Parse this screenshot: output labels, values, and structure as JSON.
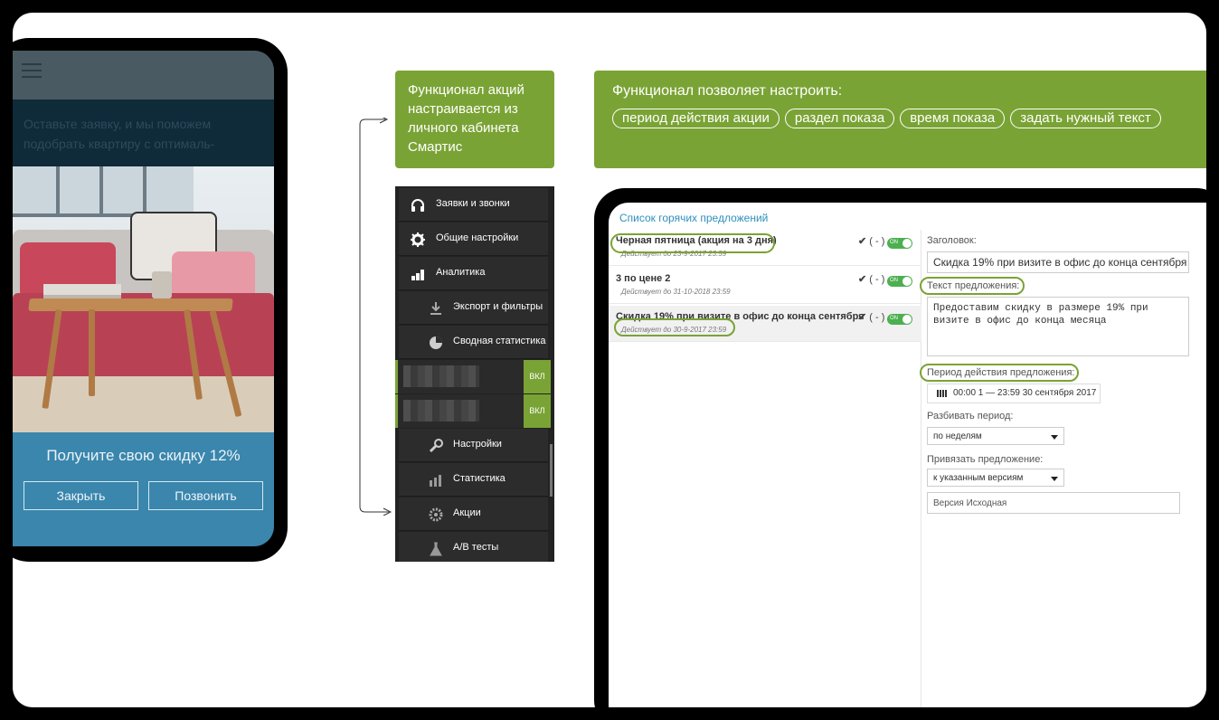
{
  "phone": {
    "description": "Оставьте заявку, и мы поможем подобрать квартиру с оптималь-",
    "promo_title": "Получите свою скидку 12%",
    "close_button": "Закрыть",
    "call_button": "Позвонить"
  },
  "intro_box": {
    "text": "Функционал акций настраивается из личного кабинета Смартис"
  },
  "features_box": {
    "title": "Функционал позволяет настроить:",
    "pills": [
      "период действия акции",
      "раздел показа",
      "время показа",
      "задать нужный текст"
    ]
  },
  "menu": {
    "items": [
      {
        "label": "Заявки и звонки",
        "icon": "headphones-icon"
      },
      {
        "label": "Общие настройки",
        "icon": "gear-icon"
      },
      {
        "label": "Аналитика",
        "icon": "bar-chart-icon"
      },
      {
        "label": "Экспорт и фильтры",
        "icon": "download-icon"
      },
      {
        "label": "Сводная статистика",
        "icon": "pie-chart-icon"
      },
      {
        "label": "Настройки",
        "icon": "wrench-icon"
      },
      {
        "label": "Статистика",
        "icon": "stats-icon"
      },
      {
        "label": "Акции",
        "icon": "badge-icon"
      },
      {
        "label": "A/B тесты",
        "icon": "flask-icon"
      }
    ],
    "blurred_badge": "ВКЛ"
  },
  "offers_panel": {
    "title": "Список горячих предложений",
    "check_label": "( - )",
    "toggle_label": "ON",
    "offers": [
      {
        "title": "Черная пятница (акция на 3 дня)",
        "date": "Действует до 23-9-2017 23:59"
      },
      {
        "title": "3 по цене 2",
        "date": "Действует до 31-10-2018 23:59"
      },
      {
        "title": "Скидка 19% при визите в офис до конца сентября",
        "date": "Действует до 30-9-2017 23:59"
      }
    ]
  },
  "form": {
    "heading_label": "Заголовок:",
    "heading_value": "Скидка 19% при визите в офис до конца сентября",
    "text_label": "Текст предложения:",
    "text_value": "Предоставим скидку в размере 19% при визите в офис до конца месяца",
    "period_label": "Период действия предложения:",
    "period_value": "00:00 1 — 23:59 30 сентября 2017",
    "split_label": "Разбивать период:",
    "split_value": "по неделям",
    "bind_label": "Привязать предложение:",
    "bind_value": "к указанным версиям",
    "version_value": "Версия Исходная"
  },
  "colors": {
    "accent_green": "#7aa335",
    "link_blue": "#2f8fbd",
    "phone_blue": "#3a86ad"
  }
}
